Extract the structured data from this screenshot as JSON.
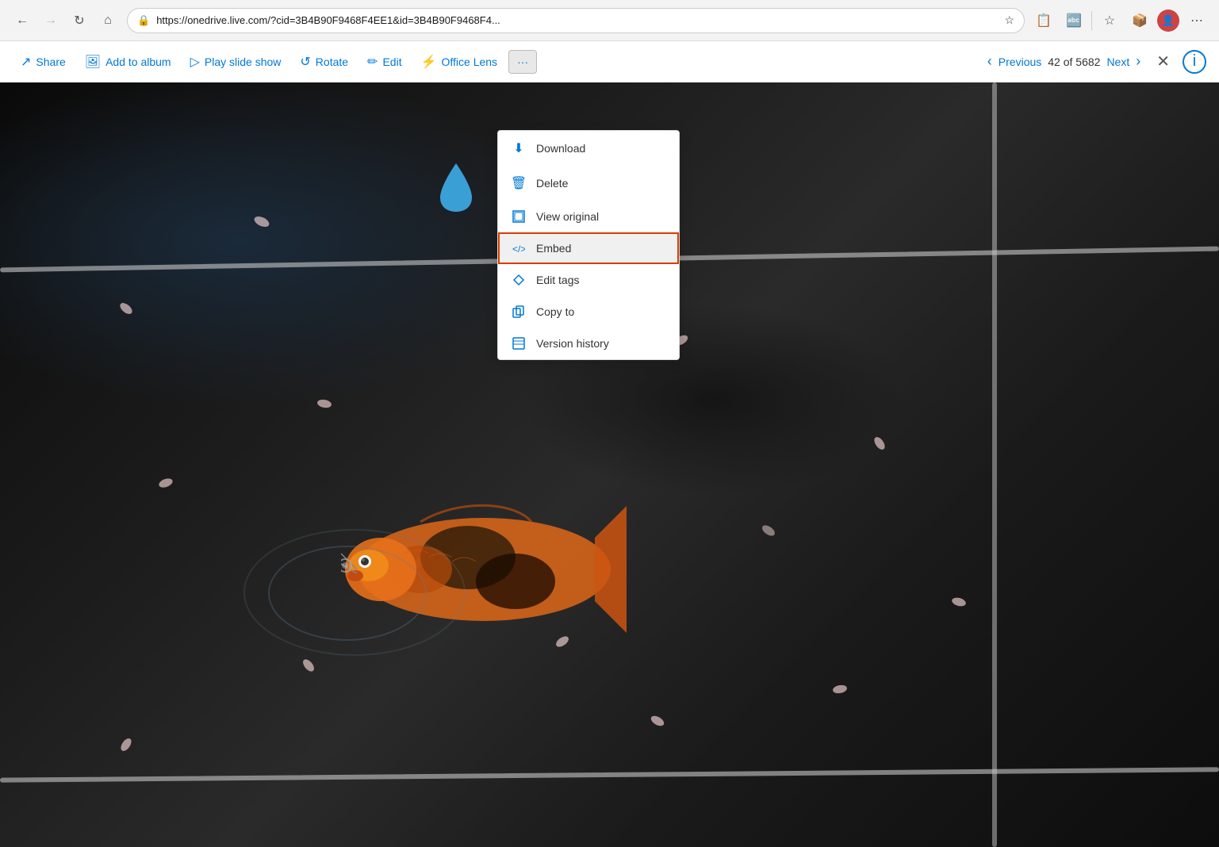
{
  "browser": {
    "back_btn": "←",
    "forward_btn": "→",
    "refresh_btn": "↻",
    "home_btn": "⌂",
    "url": "https://onedrive.live.com/?cid=3B4B90F9468F4EE1&id=3B4B90F9468F4...",
    "more_btn": "⋯"
  },
  "toolbar": {
    "share_label": "Share",
    "add_to_album_label": "Add to album",
    "play_slide_show_label": "Play slide show",
    "rotate_label": "Rotate",
    "edit_label": "Edit",
    "office_lens_label": "Office Lens",
    "more_label": "···",
    "previous_label": "Previous",
    "nav_count": "42 of 5682",
    "next_label": "Next",
    "close_label": "✕",
    "info_label": "ℹ"
  },
  "menu": {
    "items": [
      {
        "id": "download",
        "icon": "⬇",
        "label": "Download"
      },
      {
        "id": "delete",
        "icon": "🗑",
        "label": "Delete"
      },
      {
        "id": "view-original",
        "icon": "⬜",
        "label": "View original"
      },
      {
        "id": "embed",
        "icon": "</>",
        "label": "Embed",
        "highlighted": true
      },
      {
        "id": "edit-tags",
        "icon": "◇",
        "label": "Edit tags"
      },
      {
        "id": "copy-to",
        "icon": "⧉",
        "label": "Copy to"
      },
      {
        "id": "version-history",
        "icon": "⊡",
        "label": "Version history"
      }
    ]
  },
  "colors": {
    "accent": "#0078d4",
    "highlight_border": "#d83b01",
    "menu_highlight_bg": "#f0f0f0"
  }
}
